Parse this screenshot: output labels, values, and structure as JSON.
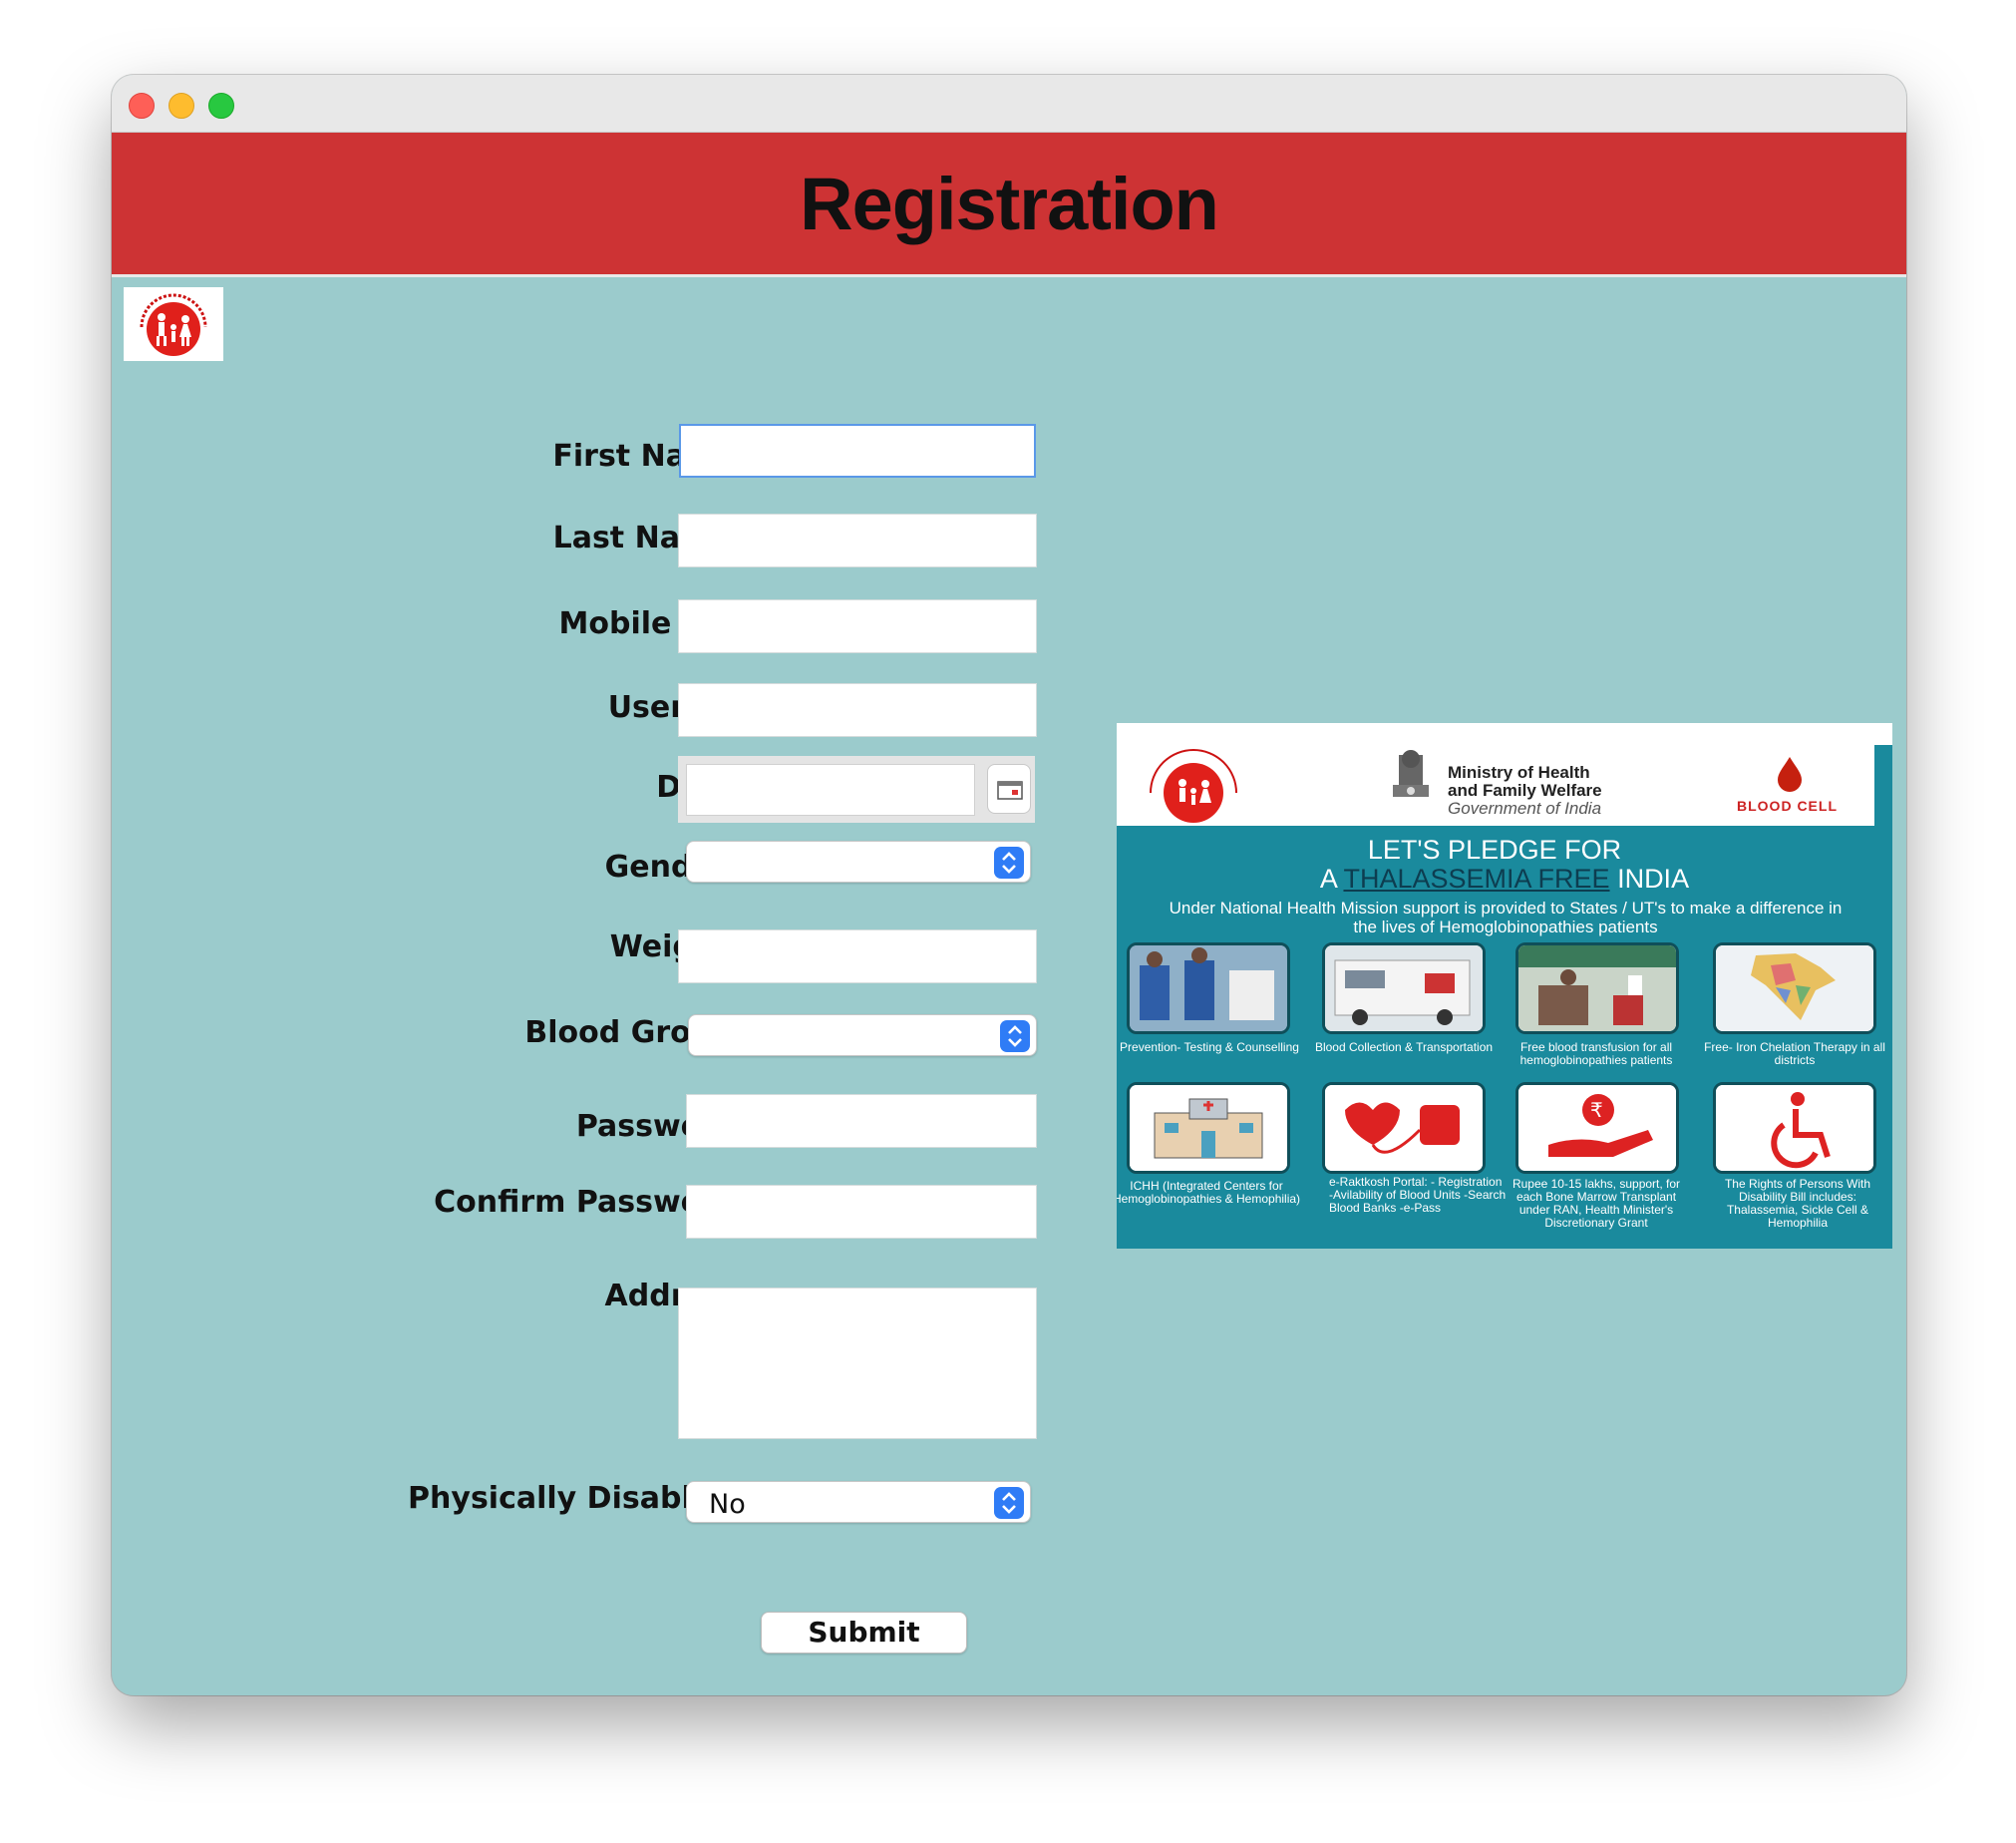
{
  "header": {
    "title": "Registration"
  },
  "form": {
    "first_name_label": "First Name :",
    "last_name_label": "Last Name :",
    "mobile_label": "Mobile No :",
    "user_id_label": "User ID :",
    "dob_label": "DOB :",
    "gender_label": "Gender :",
    "weight_label": "Weight :",
    "blood_group_label": "Blood Group :",
    "password_label": "Password :",
    "confirm_password_label": "Confirm Password :",
    "address_label": "Address :",
    "physically_disabled_label": "Physically Disabled :",
    "physically_disabled_value": "No",
    "gender_value": "",
    "blood_group_value": "",
    "submit_label": "Submit"
  },
  "poster": {
    "ministry_line1": "Ministry of Health",
    "ministry_line2": "and Family Welfare",
    "ministry_line3": "Government of India",
    "blood_cell": "BLOOD CELL",
    "pledge_line1": "LET'S PLEDGE FOR",
    "pledge_a": "A",
    "pledge_highlight": "THALASSEMIA FREE",
    "pledge_india": "INDIA",
    "support_text": "Under National Health Mission support is provided to States / UT's to make a difference in the lives of Hemoglobinopathies patients",
    "captions": [
      "Prevention- Testing & Counselling",
      "Blood Collection & Transportation",
      "Free blood transfusion for all hemoglobinopathies patients",
      "Free- Iron Chelation Therapy in all districts",
      "ICHH (Integrated Centers for Hemoglobinopathies & Hemophilia)",
      "e-Raktkosh Portal: - Registration -Avilability of Blood Units -Search Blood Banks -e-Pass",
      "Rupee 10-15 lakhs, support, for each Bone Marrow Transplant under RAN, Health Minister's Discretionary Grant",
      "The Rights of Persons With Disability Bill includes: Thalassemia, Sickle Cell & Hemophilia"
    ]
  },
  "colors": {
    "header_bg": "#cd3334",
    "body_bg": "#9bcbcc",
    "poster_teal": "#1a8a9d",
    "accent_blue": "#2f7cf6"
  },
  "icons": [
    "calendar-icon",
    "select-arrows-icon",
    "nhm-logo",
    "blood-drop-icon",
    "national-emblem"
  ]
}
